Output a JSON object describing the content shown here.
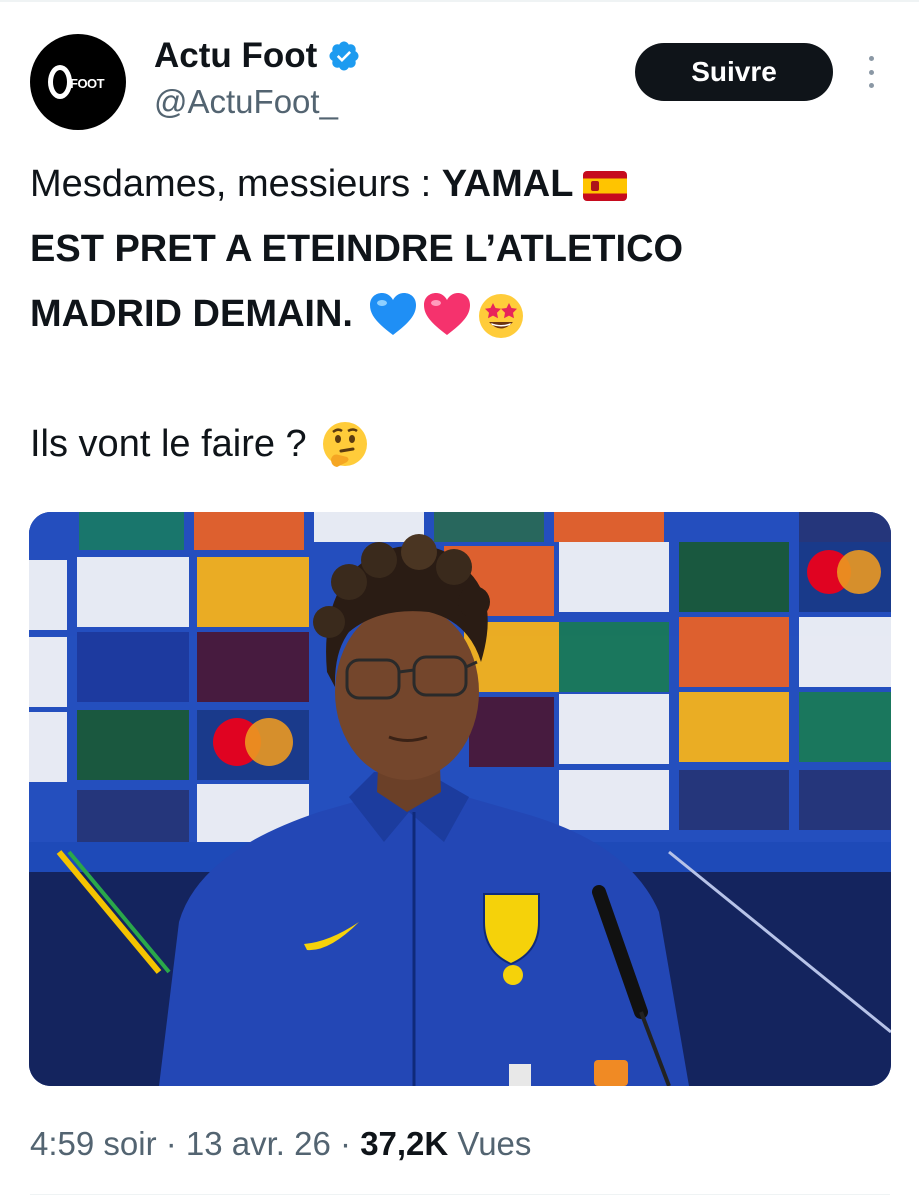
{
  "account": {
    "display_name": "Actu Foot",
    "handle": "@ActuFoot_",
    "avatar_text": "FOOT",
    "verified": true
  },
  "follow_label": "Suivre",
  "tweet": {
    "line1_normal": "Mesdames, messieurs : ",
    "line1_bold": "YAMAL",
    "line2_bold": "EST PRET A ETEINDRE L’ATLETICO",
    "line3_bold": "MADRID DEMAIN.",
    "line5": "Ils vont le faire ?",
    "emojis": [
      "flag-spain-icon",
      "blue-heart-icon",
      "pink-heart-icon",
      "star-struck-icon",
      "thinking-face-icon"
    ]
  },
  "meta": {
    "time": "4:59 soir",
    "separator": " · ",
    "date": "13 avr. 26",
    "views_count": "37,2K",
    "views_label": " Vues"
  },
  "colors": {
    "accent": "#1d9bf0",
    "text": "#0f1419",
    "secondary": "#536471",
    "follow_bg": "#0f1419"
  }
}
